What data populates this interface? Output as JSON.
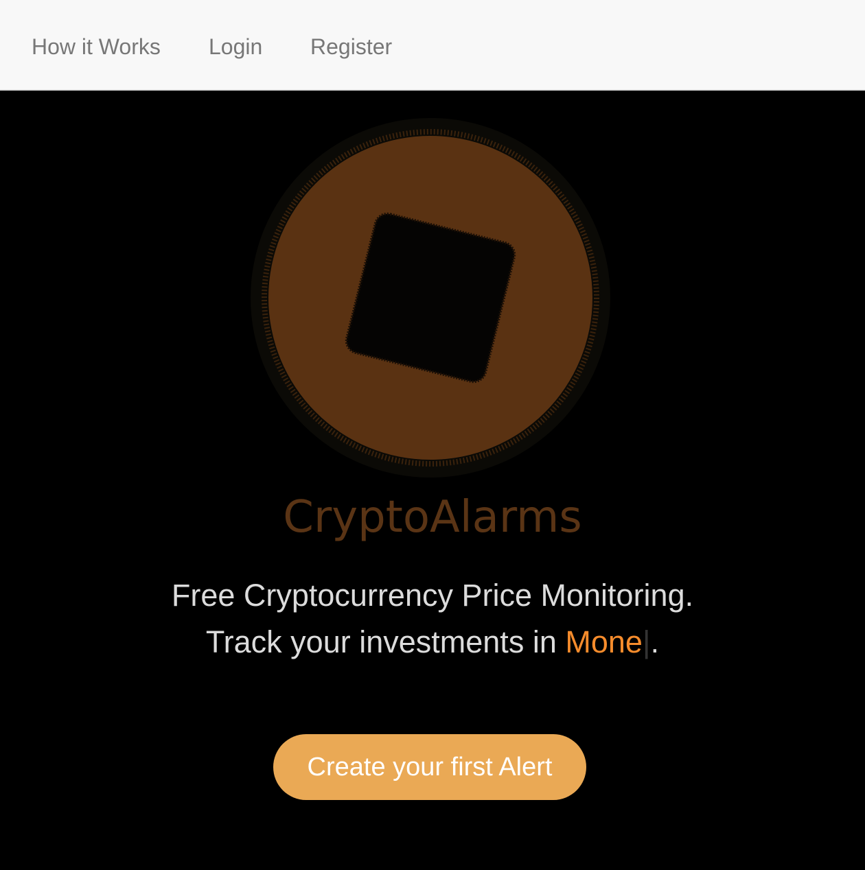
{
  "nav": {
    "items": [
      {
        "label": "How it Works"
      },
      {
        "label": "Login"
      },
      {
        "label": "Register"
      }
    ]
  },
  "hero": {
    "brand_name": "CryptoAlarms",
    "tagline_line1": "Free Cryptocurrency Price Monitoring.",
    "tagline_line2_prefix": "Track your investments in ",
    "tagline_typed_word": "Mone",
    "tagline_cursor": "|",
    "tagline_line2_suffix": ".",
    "cta_label": "Create your first Alert"
  },
  "colors": {
    "nav_background": "#f8f8f8",
    "nav_text": "#777777",
    "hero_background": "#000000",
    "logo_fill": "#5a3212",
    "accent_orange": "#f68c2c",
    "cta_background": "#eaa955",
    "tagline_text": "#dcdcdc"
  },
  "icons": {
    "logo": "cryptoalarms-logo-icon"
  }
}
